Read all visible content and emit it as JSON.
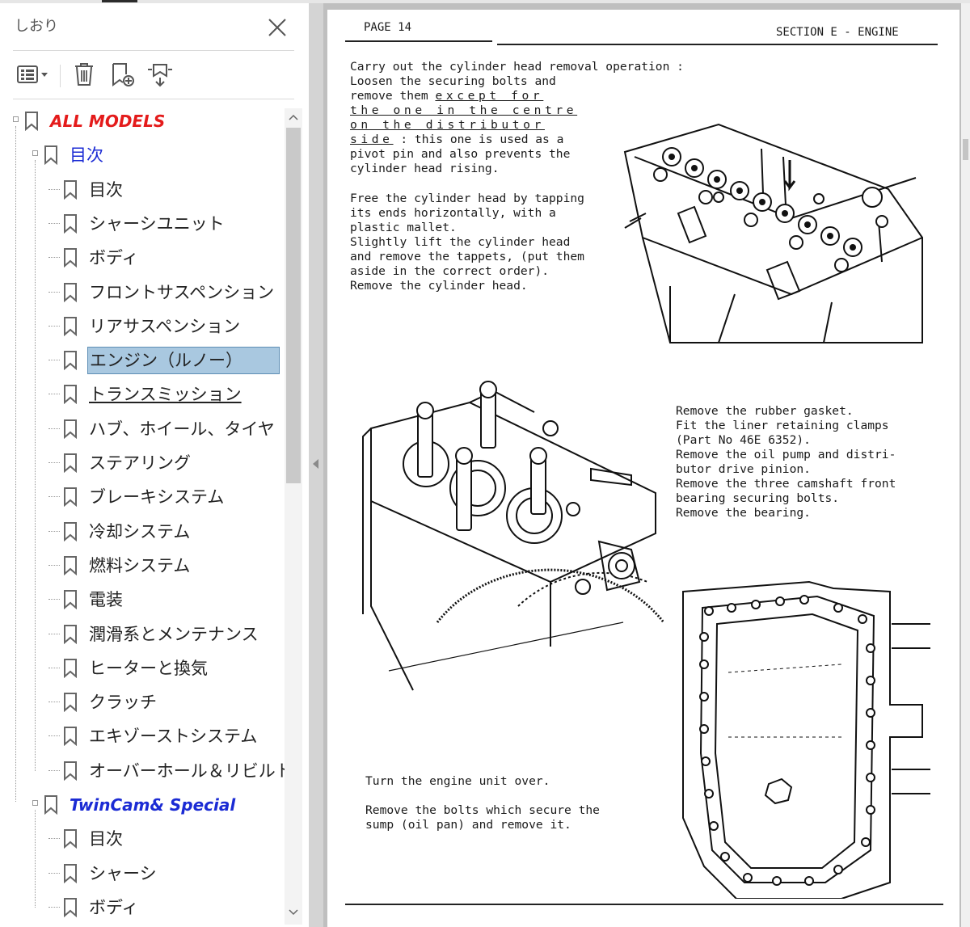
{
  "sidebar": {
    "title": "しおり",
    "tools": [
      "options-menu-icon",
      "delete-bookmark-icon",
      "new-bookmark-icon",
      "expand-bookmark-icon"
    ],
    "tree": {
      "root": "ALL MODELS",
      "group1": {
        "label": "目次",
        "items": [
          "目次",
          "シャーシユニット",
          "ボディ",
          "フロントサスペンション",
          "リアサスペンション",
          "エンジン（ルノー）",
          "トランスミッション",
          "ハブ、ホイール、タイヤ",
          "ステアリング",
          "ブレーキシステム",
          "冷却システム",
          "燃料システム",
          "電装",
          "潤滑系とメンテナンス",
          "ヒーターと換気",
          "クラッチ",
          "エキゾーストシステム",
          "オーバーホール＆リビルト"
        ]
      },
      "group2": {
        "label": "TwinCam& Special",
        "items": [
          "目次",
          "シャーシ",
          "ボディ"
        ]
      },
      "selected_index": 5
    }
  },
  "document": {
    "page_label": "PAGE 14",
    "section_label": "SECTION E - ENGINE",
    "block1": {
      "line1": "Carry out the cylinder head removal operation :",
      "line2": "Loosen the securing bolts and",
      "line3a": "remove them ",
      "line3b": "except for",
      "line4": "the one in the centre",
      "line5": "on the distributor",
      "line6a": "side",
      "line6b": " : this one is used as a",
      "line7": "pivot pin and also prevents the",
      "line8": "cylinder head rising.",
      "line9": "Free the cylinder head by tapping",
      "line10": "its ends horizontally, with a",
      "line11": "plastic mallet.",
      "line12": "Slightly lift the cylinder head",
      "line13": "and remove the tappets, (put them",
      "line14": "aside in the correct order).",
      "line15": "Remove the cylinder head."
    },
    "block2": {
      "line1": "Remove the rubber gasket.",
      "line2": "Fit the liner retaining clamps",
      "line3": "(Part No 46E 6352).",
      "line4": "Remove the oil pump and distri-",
      "line5": "butor drive pinion.",
      "line6": "Remove the three camshaft front",
      "line7": "bearing securing bolts.",
      "line8": "Remove the bearing."
    },
    "block3": {
      "line1": "Turn the engine unit over.",
      "line2": "Remove the bolts which secure the",
      "line3": "sump (oil pan) and remove it."
    }
  },
  "colors": {
    "selected_bg": "#a9c8e0",
    "root_label": "#e41b1b",
    "group_label": "#1b2bd4",
    "viewer_bg": "#bfbfbf"
  }
}
